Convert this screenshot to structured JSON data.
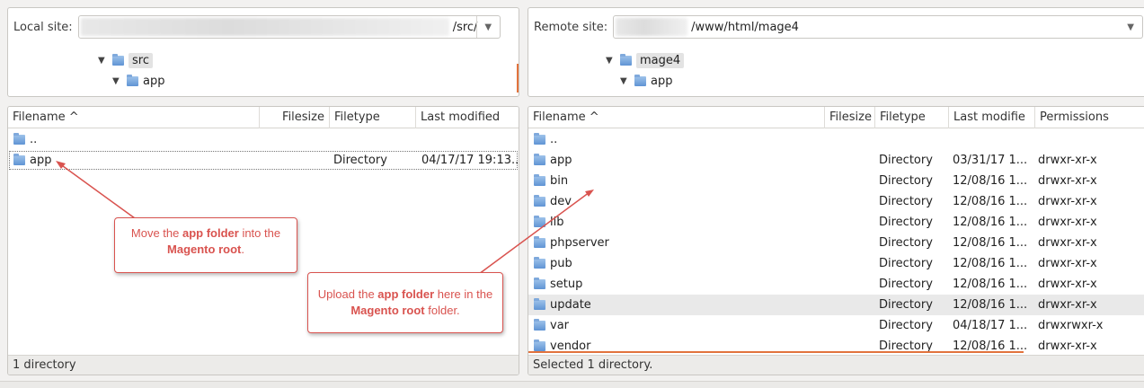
{
  "local": {
    "site_label": "Local site:",
    "site_path": "/src/",
    "tree": [
      {
        "label": "src",
        "expanded": true,
        "selected": true
      },
      {
        "label": "app",
        "expanded": true,
        "selected": false
      }
    ],
    "columns": [
      "Filename ^",
      "Filesize",
      "Filetype",
      "Last modified"
    ],
    "rows": [
      {
        "name": "..",
        "filesize": "",
        "filetype": "",
        "modified": ""
      },
      {
        "name": "app",
        "filesize": "",
        "filetype": "Directory",
        "modified": "04/17/17 19:13.."
      }
    ],
    "status": "1 directory"
  },
  "remote": {
    "site_label": "Remote site:",
    "site_path": "/www/html/mage4",
    "tree": [
      {
        "label": "mage4",
        "expanded": true,
        "selected": true
      },
      {
        "label": "app",
        "expanded": true,
        "selected": false
      }
    ],
    "columns": [
      "Filename ^",
      "Filesize",
      "Filetype",
      "Last modifie",
      "Permissions"
    ],
    "rows": [
      {
        "name": "..",
        "filetype": "",
        "modified": "",
        "perms": ""
      },
      {
        "name": "app",
        "filetype": "Directory",
        "modified": "03/31/17 1...",
        "perms": "drwxr-xr-x"
      },
      {
        "name": "bin",
        "filetype": "Directory",
        "modified": "12/08/16 1...",
        "perms": "drwxr-xr-x"
      },
      {
        "name": "dev",
        "filetype": "Directory",
        "modified": "12/08/16 1...",
        "perms": "drwxr-xr-x"
      },
      {
        "name": "lib",
        "filetype": "Directory",
        "modified": "12/08/16 1...",
        "perms": "drwxr-xr-x"
      },
      {
        "name": "phpserver",
        "filetype": "Directory",
        "modified": "12/08/16 1...",
        "perms": "drwxr-xr-x"
      },
      {
        "name": "pub",
        "filetype": "Directory",
        "modified": "12/08/16 1...",
        "perms": "drwxr-xr-x"
      },
      {
        "name": "setup",
        "filetype": "Directory",
        "modified": "12/08/16 1...",
        "perms": "drwxr-xr-x"
      },
      {
        "name": "update",
        "filetype": "Directory",
        "modified": "12/08/16 1...",
        "perms": "drwxr-xr-x"
      },
      {
        "name": "var",
        "filetype": "Directory",
        "modified": "04/18/17 1...",
        "perms": "drwxrwxr-x"
      },
      {
        "name": "vendor",
        "filetype": "Directory",
        "modified": "12/08/16 1...",
        "perms": "drwxr-xr-x"
      }
    ],
    "status": "Selected 1 directory."
  },
  "callouts": {
    "move": {
      "pre": "Move the ",
      "b1": "app folder",
      "mid": " into the ",
      "b2": "Magento root",
      "post": "."
    },
    "upload": {
      "pre": "Upload the ",
      "b1": "app folder",
      "mid": " here in the ",
      "b2": "Magento root",
      "post": " folder."
    }
  },
  "colors": {
    "accent": "#e2733d",
    "callout": "#d9534f",
    "folder": "#5f94d4"
  }
}
